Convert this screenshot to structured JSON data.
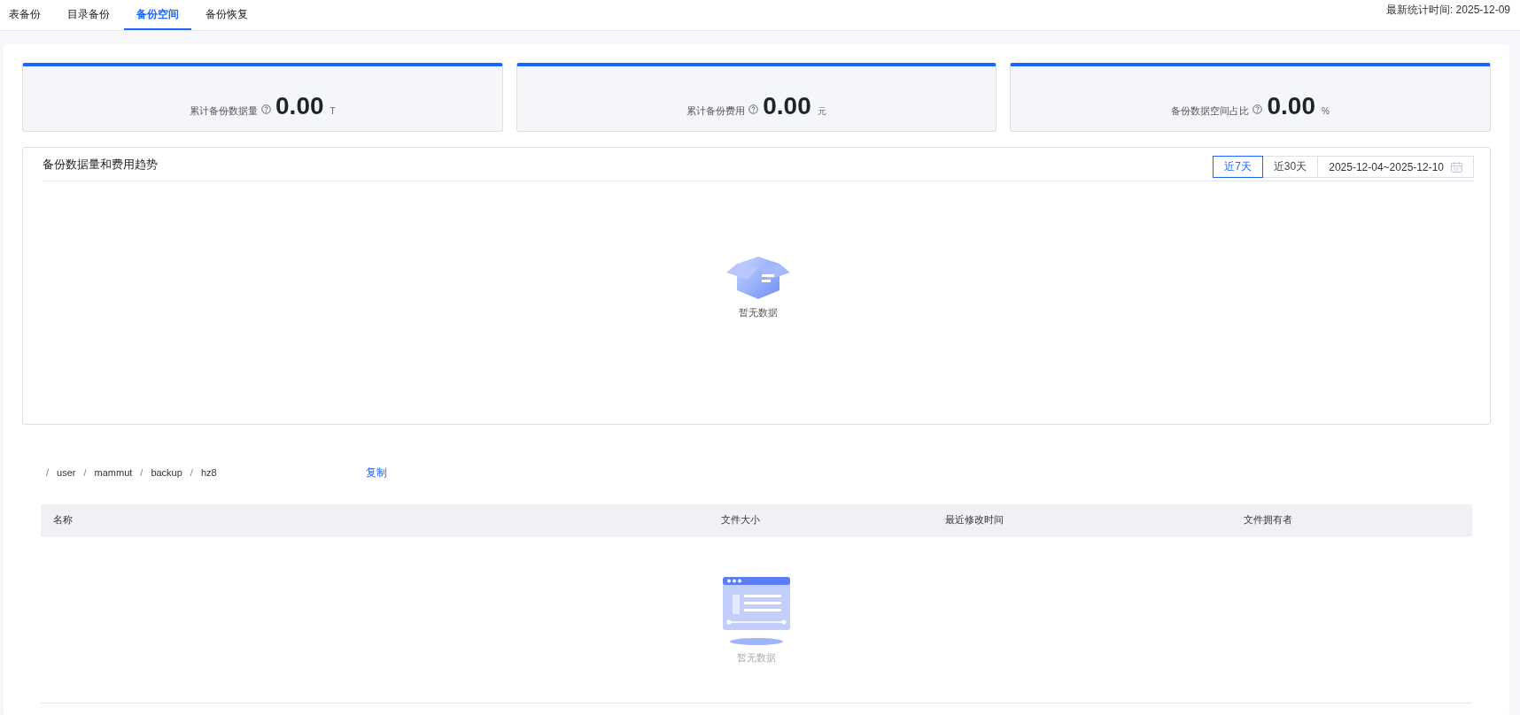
{
  "tabs": [
    {
      "label": "表备份",
      "selected": false
    },
    {
      "label": "目录备份",
      "selected": false
    },
    {
      "label": "备份空间",
      "selected": true
    },
    {
      "label": "备份恢复",
      "selected": false
    }
  ],
  "stat_time": "最新统计时间: 2025-12-09",
  "stat_cards": [
    {
      "label": "累计备份数据量",
      "value": "0.00",
      "unit": "T"
    },
    {
      "label": "累计备份费用",
      "value": "0.00",
      "unit": "元"
    },
    {
      "label": "备份数据空间占比",
      "value": "0.00",
      "unit": "%"
    }
  ],
  "trend_panel": {
    "title": "备份数据量和费用趋势",
    "ranges": [
      {
        "label": "近7天",
        "selected": true
      },
      {
        "label": "近30天",
        "selected": false
      }
    ],
    "date_range": "2025-12-04~2025-12-10",
    "empty_text": "暂无数据"
  },
  "breadcrumb": [
    {
      "kind": "separator",
      "text": "/"
    },
    {
      "kind": "segment",
      "text": "user"
    },
    {
      "kind": "separator",
      "text": "/"
    },
    {
      "kind": "segment",
      "text": "mammut"
    },
    {
      "kind": "separator",
      "text": "/"
    },
    {
      "kind": "segment",
      "text": "backup"
    },
    {
      "kind": "separator",
      "text": "/"
    },
    {
      "kind": "segment",
      "text": "hz8"
    }
  ],
  "copy_link": "复制",
  "table": {
    "columns": [
      "名称",
      "文件大小",
      "最近修改时间",
      "文件拥有者"
    ],
    "empty_text": "暂无数据"
  }
}
